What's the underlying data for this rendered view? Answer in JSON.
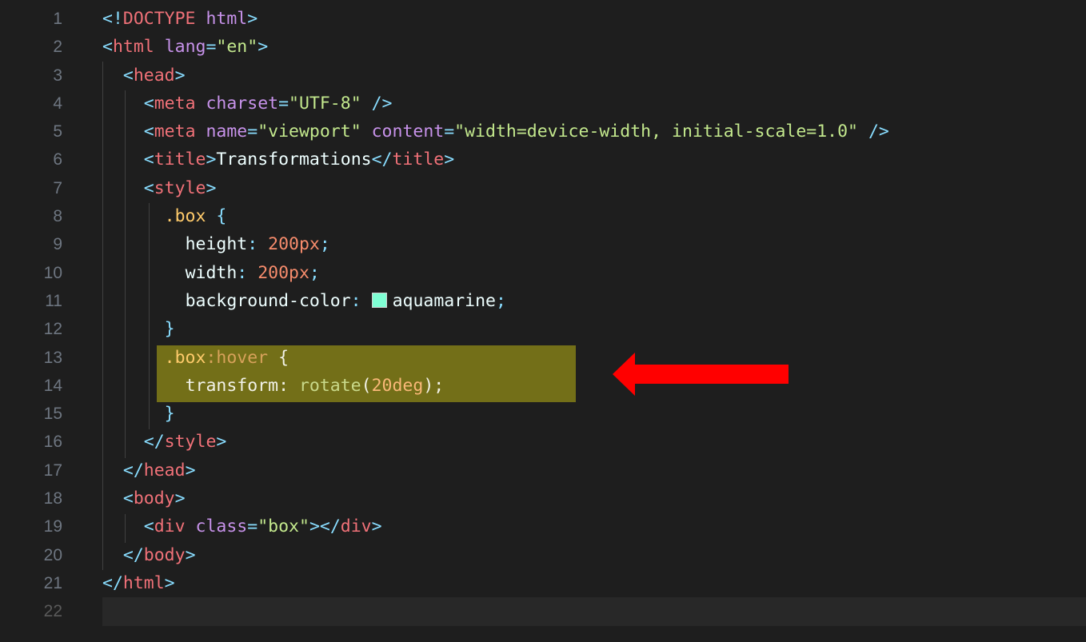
{
  "line_numbers": [
    "1",
    "2",
    "3",
    "4",
    "5",
    "6",
    "7",
    "8",
    "9",
    "10",
    "11",
    "12",
    "13",
    "14",
    "15",
    "16",
    "17",
    "18",
    "19",
    "20",
    "21",
    "22"
  ],
  "code": {
    "l1": {
      "open": "<!",
      "doctype": "DOCTYPE",
      "html": "html",
      "close": ">"
    },
    "l2": {
      "open": "<",
      "tag": "html",
      "attr": "lang",
      "eq": "=",
      "val": "\"en\"",
      "close": ">"
    },
    "l3": {
      "open": "<",
      "tag": "head",
      "close": ">"
    },
    "l4": {
      "open": "<",
      "tag": "meta",
      "attr": "charset",
      "eq": "=",
      "val": "\"UTF-8\"",
      "close": " />"
    },
    "l5": {
      "open": "<",
      "tag": "meta",
      "attr1": "name",
      "eq1": "=",
      "val1": "\"viewport\"",
      "attr2": "content",
      "eq2": "=",
      "val2": "\"width=device-width, initial-scale=1.0\"",
      "close": " />"
    },
    "l6": {
      "open": "<",
      "tag": "title",
      "close": ">",
      "text": "Transformations",
      "open2": "</",
      "tag2": "title",
      "close2": ">"
    },
    "l7": {
      "open": "<",
      "tag": "style",
      "close": ">"
    },
    "l8": {
      "sel": ".box",
      "brace": " {"
    },
    "l9": {
      "prop": "height",
      "colon": ": ",
      "num": "200px",
      "semi": ";"
    },
    "l10": {
      "prop": "width",
      "colon": ": ",
      "num": "200px",
      "semi": ";"
    },
    "l11": {
      "prop": "background-color",
      "colon": ": ",
      "val": "aquamarine",
      "semi": ";"
    },
    "l12": {
      "brace": "}"
    },
    "l13": {
      "sel": ".box",
      "pseudo": ":hover",
      "brace": " {"
    },
    "l14": {
      "prop": "transform",
      "colon": ": ",
      "fn": "rotate",
      "paren_open": "(",
      "num": "20deg",
      "paren_close": ")",
      "semi": ";"
    },
    "l15": {
      "brace": "}"
    },
    "l16": {
      "open": "</",
      "tag": "style",
      "close": ">"
    },
    "l17": {
      "open": "</",
      "tag": "head",
      "close": ">"
    },
    "l18": {
      "open": "<",
      "tag": "body",
      "close": ">"
    },
    "l19": {
      "open": "<",
      "tag": "div",
      "attr": "class",
      "eq": "=",
      "val": "\"box\"",
      "close": ">",
      "open2": "</",
      "tag2": "div",
      "close2": ">"
    },
    "l20": {
      "open": "</",
      "tag": "body",
      "close": ">"
    },
    "l21": {
      "open": "</",
      "tag": "html",
      "close": ">"
    }
  },
  "colors": {
    "editor_bg": "#1e1e1e",
    "highlight": "#736f18",
    "arrow": "#ff0000",
    "swatch_aquamarine": "#7fffd4"
  },
  "annotation": {
    "arrow": "arrow-icon",
    "points_to": "line 13-14"
  }
}
